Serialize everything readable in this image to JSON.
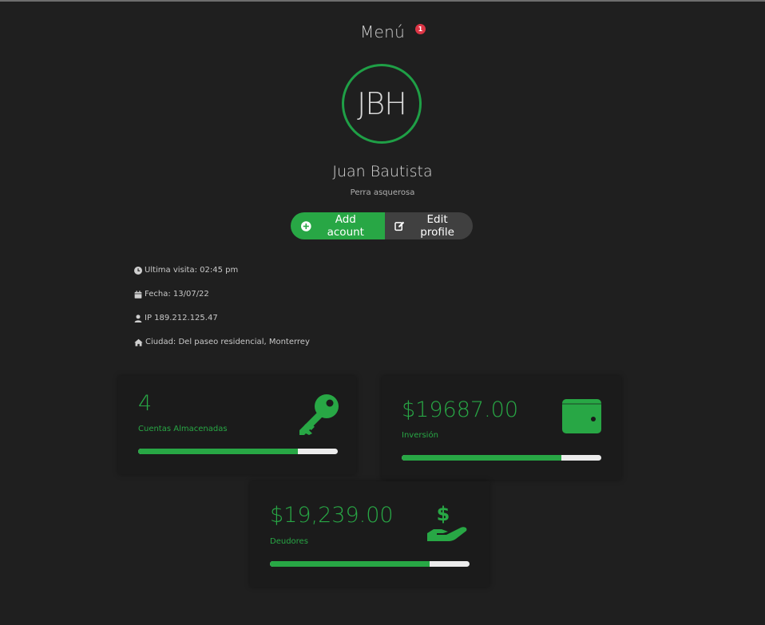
{
  "header": {
    "title": "Menú",
    "badge": "1"
  },
  "profile": {
    "initials": "JBH",
    "name": "Juan Bautista",
    "subtitle": "Perra asquerosa"
  },
  "actions": {
    "add_label": "Add acount",
    "edit_label": "Edit profile"
  },
  "info": {
    "last_visit": "Ultima visita: 02:45 pm",
    "date": "Fecha: 13/07/22",
    "ip": "IP 189.212.125.47",
    "city": "Ciudad: Del paseo residencial, Monterrey"
  },
  "cards": [
    {
      "value": "4",
      "label": "Cuentas Almacenadas",
      "icon": "key-icon",
      "progress": 0.8
    },
    {
      "value": "$19687.00",
      "label": "Inversión",
      "icon": "wallet-icon",
      "progress": 0.8
    },
    {
      "value": "$19,239.00",
      "label": "Deudores",
      "icon": "hand-money-icon",
      "progress": 0.8
    }
  ],
  "colors": {
    "accent": "#28a745",
    "background": "#1f1f1f",
    "badge": "#dc3545"
  }
}
